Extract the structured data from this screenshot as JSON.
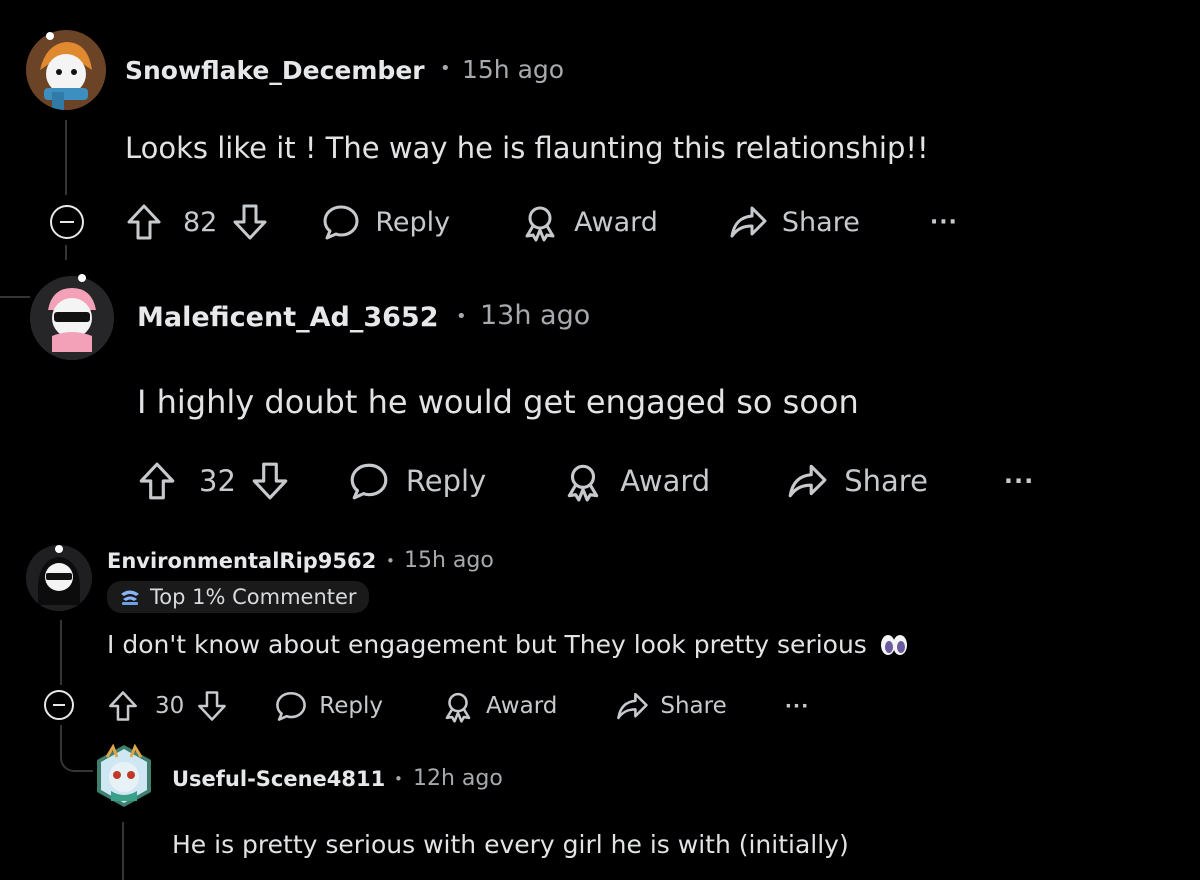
{
  "comments": [
    {
      "username": "Snowflake_December",
      "time": "15h ago",
      "body": "Looks like it ! The way he is flaunting this relationship!!",
      "votes": "82",
      "reply_label": "Reply",
      "award_label": "Award",
      "share_label": "Share",
      "more_label": "···"
    },
    {
      "username": "Maleficent_Ad_3652",
      "time": "13h ago",
      "body": "I highly doubt he would get engaged so soon",
      "votes": "32",
      "reply_label": "Reply",
      "award_label": "Award",
      "share_label": "Share",
      "more_label": "···"
    },
    {
      "username": "EnvironmentalRip9562",
      "time": "15h ago",
      "badge": "Top 1% Commenter",
      "body": "I don't know about engagement but They look pretty serious",
      "votes": "30",
      "reply_label": "Reply",
      "award_label": "Award",
      "share_label": "Share",
      "more_label": "···"
    },
    {
      "username": "Useful-Scene4811",
      "time": "12h ago",
      "body": "He is pretty serious with every girl he is with (initially)"
    }
  ],
  "separator": "•",
  "colors": {
    "background": "#000000",
    "thread_line": "#343536",
    "text": "#e1e3e5",
    "meta": "#a7aaad"
  }
}
